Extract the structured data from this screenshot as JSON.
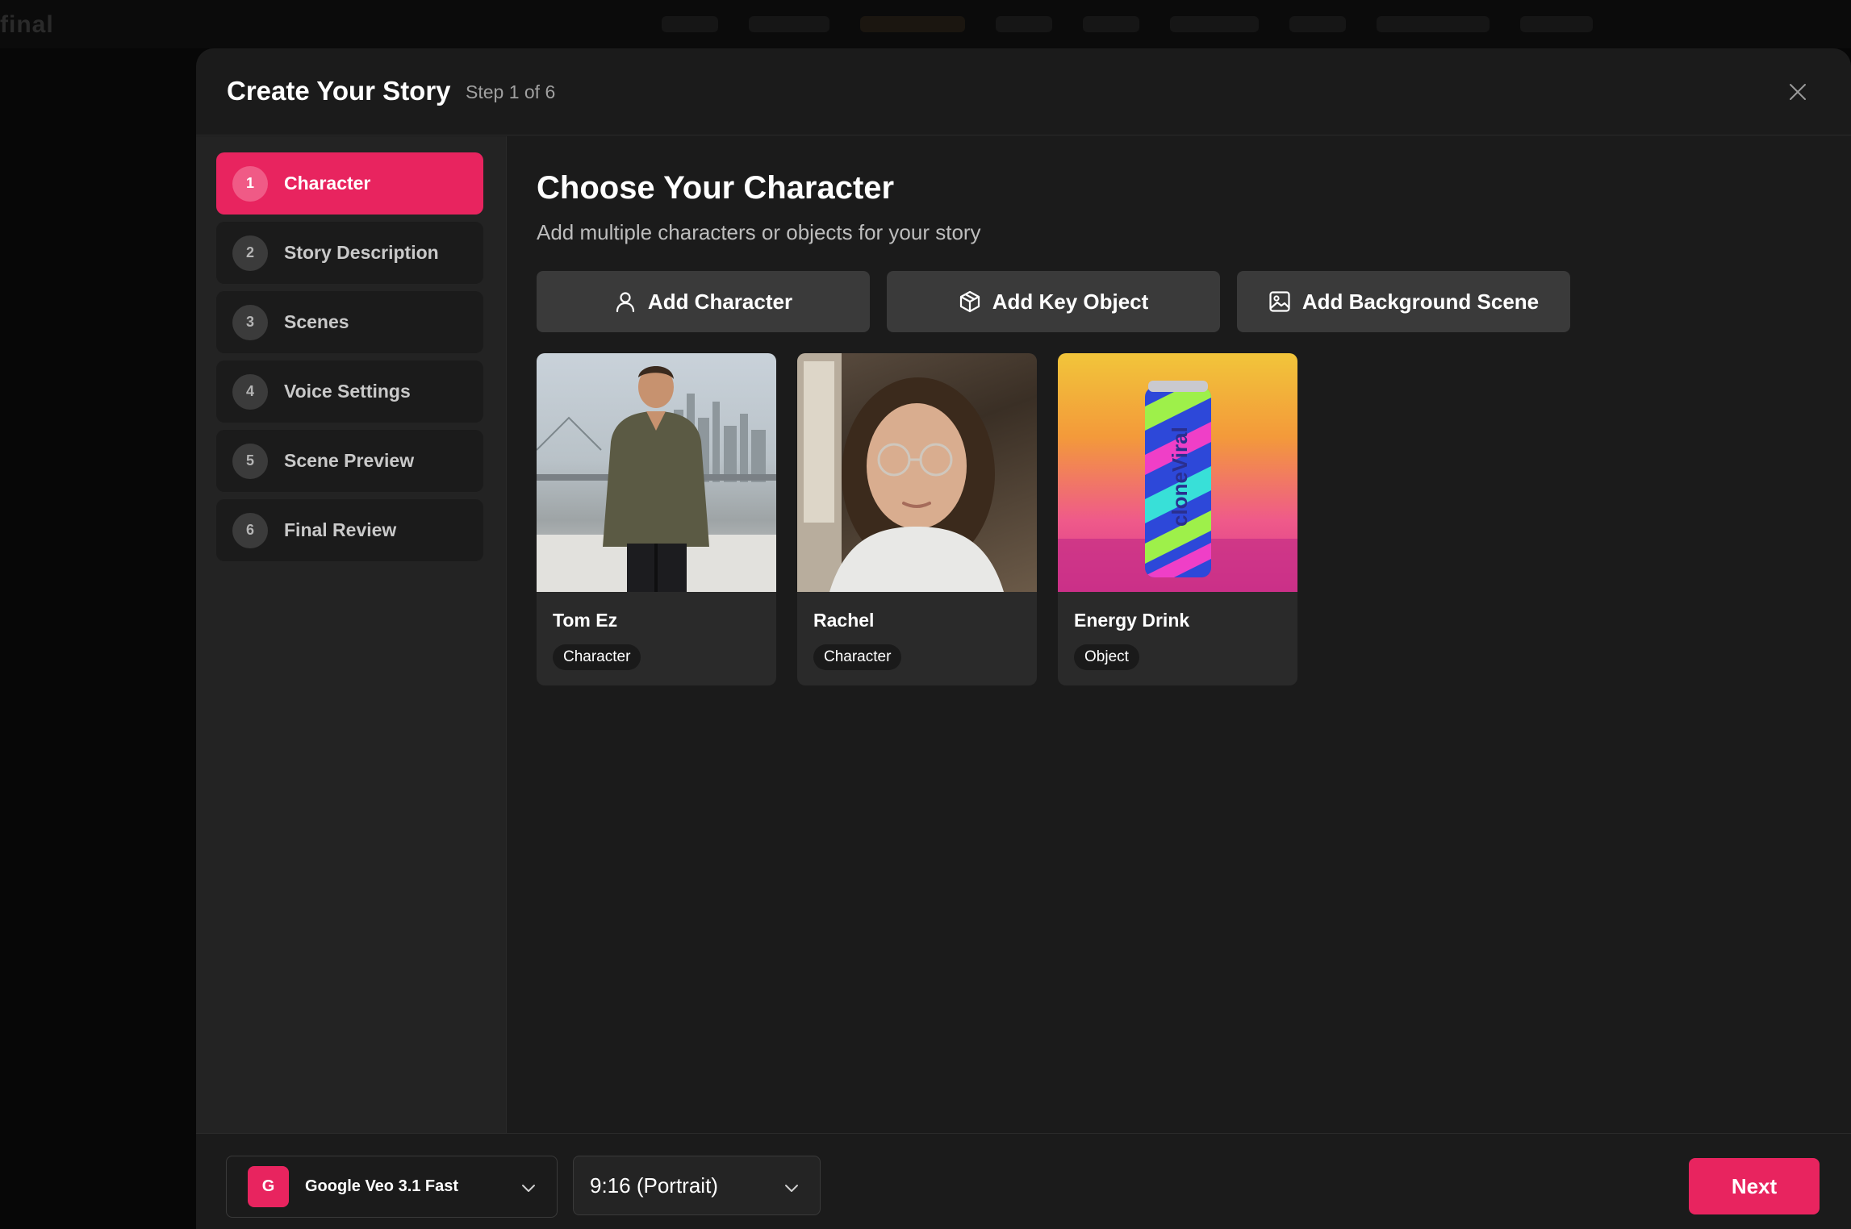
{
  "background": {
    "logo_text": "final"
  },
  "modal": {
    "title": "Create Your Story",
    "step_indicator": "Step 1 of 6"
  },
  "steps": [
    {
      "num": "1",
      "label": "Character",
      "active": true
    },
    {
      "num": "2",
      "label": "Story Description",
      "active": false
    },
    {
      "num": "3",
      "label": "Scenes",
      "active": false
    },
    {
      "num": "4",
      "label": "Voice Settings",
      "active": false
    },
    {
      "num": "5",
      "label": "Scene Preview",
      "active": false
    },
    {
      "num": "6",
      "label": "Final Review",
      "active": false
    }
  ],
  "main": {
    "title": "Choose Your Character",
    "subtitle": "Add multiple characters or objects for your story",
    "actions": [
      {
        "label": "Add Character",
        "icon": "user-icon"
      },
      {
        "label": "Add Key Object",
        "icon": "cube-icon"
      },
      {
        "label": "Add Background Scene",
        "icon": "image-icon"
      }
    ],
    "cards": [
      {
        "name": "Tom Ez",
        "tag": "Character"
      },
      {
        "name": "Rachel",
        "tag": "Character"
      },
      {
        "name": "Energy Drink",
        "tag": "Object",
        "can_text": "cloneViral"
      }
    ]
  },
  "footer": {
    "model_badge": "G",
    "model_label": "Google Veo 3.1 Fast",
    "ratio_label": "9:16 (Portrait)",
    "next_label": "Next"
  },
  "colors": {
    "accent": "#e8245f",
    "modal_bg": "#1b1b1b",
    "sidebar_bg": "#232323",
    "button_bg": "#3a3a3a"
  }
}
